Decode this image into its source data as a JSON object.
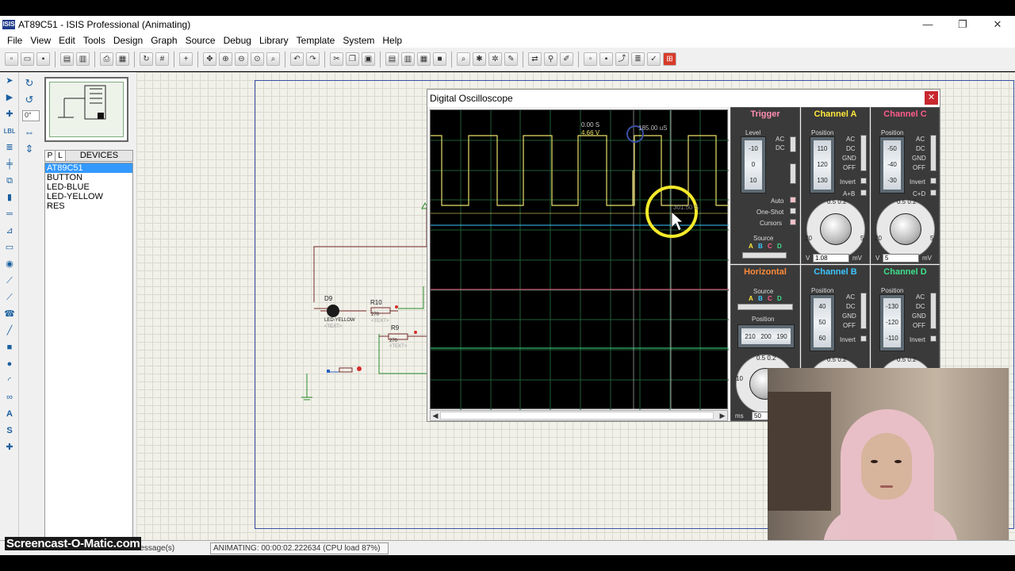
{
  "window": {
    "icon_text": "ISIS",
    "title": "AT89C51 - ISIS Professional (Animating)",
    "minimize": "—",
    "restore": "❐",
    "close": "✕"
  },
  "menu": [
    "File",
    "View",
    "Edit",
    "Tools",
    "Design",
    "Graph",
    "Source",
    "Debug",
    "Library",
    "Template",
    "System",
    "Help"
  ],
  "left_panel": {
    "angle": "0°",
    "tab_p": "P",
    "tab_l": "L",
    "devices_title": "DEVICES",
    "devices": [
      "AT89C51",
      "BUTTON",
      "LED-BLUE",
      "LED-YELLOW",
      "RES"
    ],
    "selected_device": "AT89C51"
  },
  "schematic": {
    "led_ref": "D9",
    "led_value": "LED-YELLOW",
    "led_text": "<TEXT>",
    "r10_ref": "R10",
    "r10_value": "270",
    "r10_text": "<TEXT>",
    "r9_ref": "R9",
    "r9_value": "270",
    "r9_text": "<TEXT>"
  },
  "oscilloscope": {
    "title": "Digital Oscilloscope",
    "close": "✕",
    "readout_time": "0.00 S",
    "readout_volt": "4.66 V",
    "cursor_time": "185.00 uS",
    "cursor_label": "301.50 S",
    "trigger": {
      "title": "Trigger",
      "level_label": "Level",
      "level_values": [
        "-10",
        "0",
        "10"
      ],
      "ac": "AC",
      "dc": "DC",
      "auto": "Auto",
      "one_shot": "One-Shot",
      "cursors": "Cursors",
      "source_label": "Source",
      "source_letters": [
        "A",
        "B",
        "C",
        "D"
      ]
    },
    "channel_a": {
      "title": "Channel A",
      "position_label": "Position",
      "position_values": [
        "110",
        "120",
        "130"
      ],
      "modes": [
        "AC",
        "DC",
        "GND",
        "OFF"
      ],
      "invert": "Invert",
      "sum": "A+B",
      "scale_value": "1.08",
      "unit_left": "V",
      "unit_right": "mV",
      "dial_min": "20",
      "dial_max": "5",
      "dial_top": "0.5 0.2"
    },
    "channel_c": {
      "title": "Channel C",
      "position_label": "Position",
      "position_values": [
        "-50",
        "-40",
        "-30"
      ],
      "modes": [
        "AC",
        "DC",
        "GND",
        "OFF"
      ],
      "invert": "Invert",
      "sum": "C+D",
      "scale_value": "5",
      "unit_left": "V",
      "unit_right": "mV",
      "dial_min": "20",
      "dial_max": "5",
      "dial_top": "0.5 0.2"
    },
    "horizontal": {
      "title": "Horizontal",
      "source_label": "Source",
      "source_letters": [
        "A",
        "B",
        "C",
        "D"
      ],
      "position_label": "Position",
      "position_values": [
        "210",
        "200",
        "190"
      ],
      "scale_value": "50",
      "unit_left": "ms",
      "dial_left": "10",
      "dial_top": "0.5 0.2"
    },
    "channel_b": {
      "title": "Channel B",
      "position_label": "Position",
      "position_values": [
        "40",
        "50",
        "60"
      ],
      "modes": [
        "AC",
        "DC",
        "GND",
        "OFF"
      ],
      "invert": "Invert",
      "dial_top": "0.5 0.2"
    },
    "channel_d": {
      "title": "Channel D",
      "position_label": "Position",
      "position_values": [
        "-130",
        "-120",
        "-110"
      ],
      "modes": [
        "AC",
        "DC",
        "GND",
        "OFF"
      ],
      "invert": "Invert",
      "dial_top": "0.5 0.2"
    },
    "colors": {
      "trigger": "#ff8fb0",
      "channel_a": "#ffe83a",
      "channel_b": "#3ec6ff",
      "channel_c": "#ff5a8a",
      "channel_d": "#3fe08c",
      "horizontal": "#ff8a3a"
    }
  },
  "status": {
    "message": "Message(s)",
    "animating": "ANIMATING: 00:00:02.222634 (CPU load 87%)"
  },
  "watermark": "Screencast-O-Matic.com"
}
